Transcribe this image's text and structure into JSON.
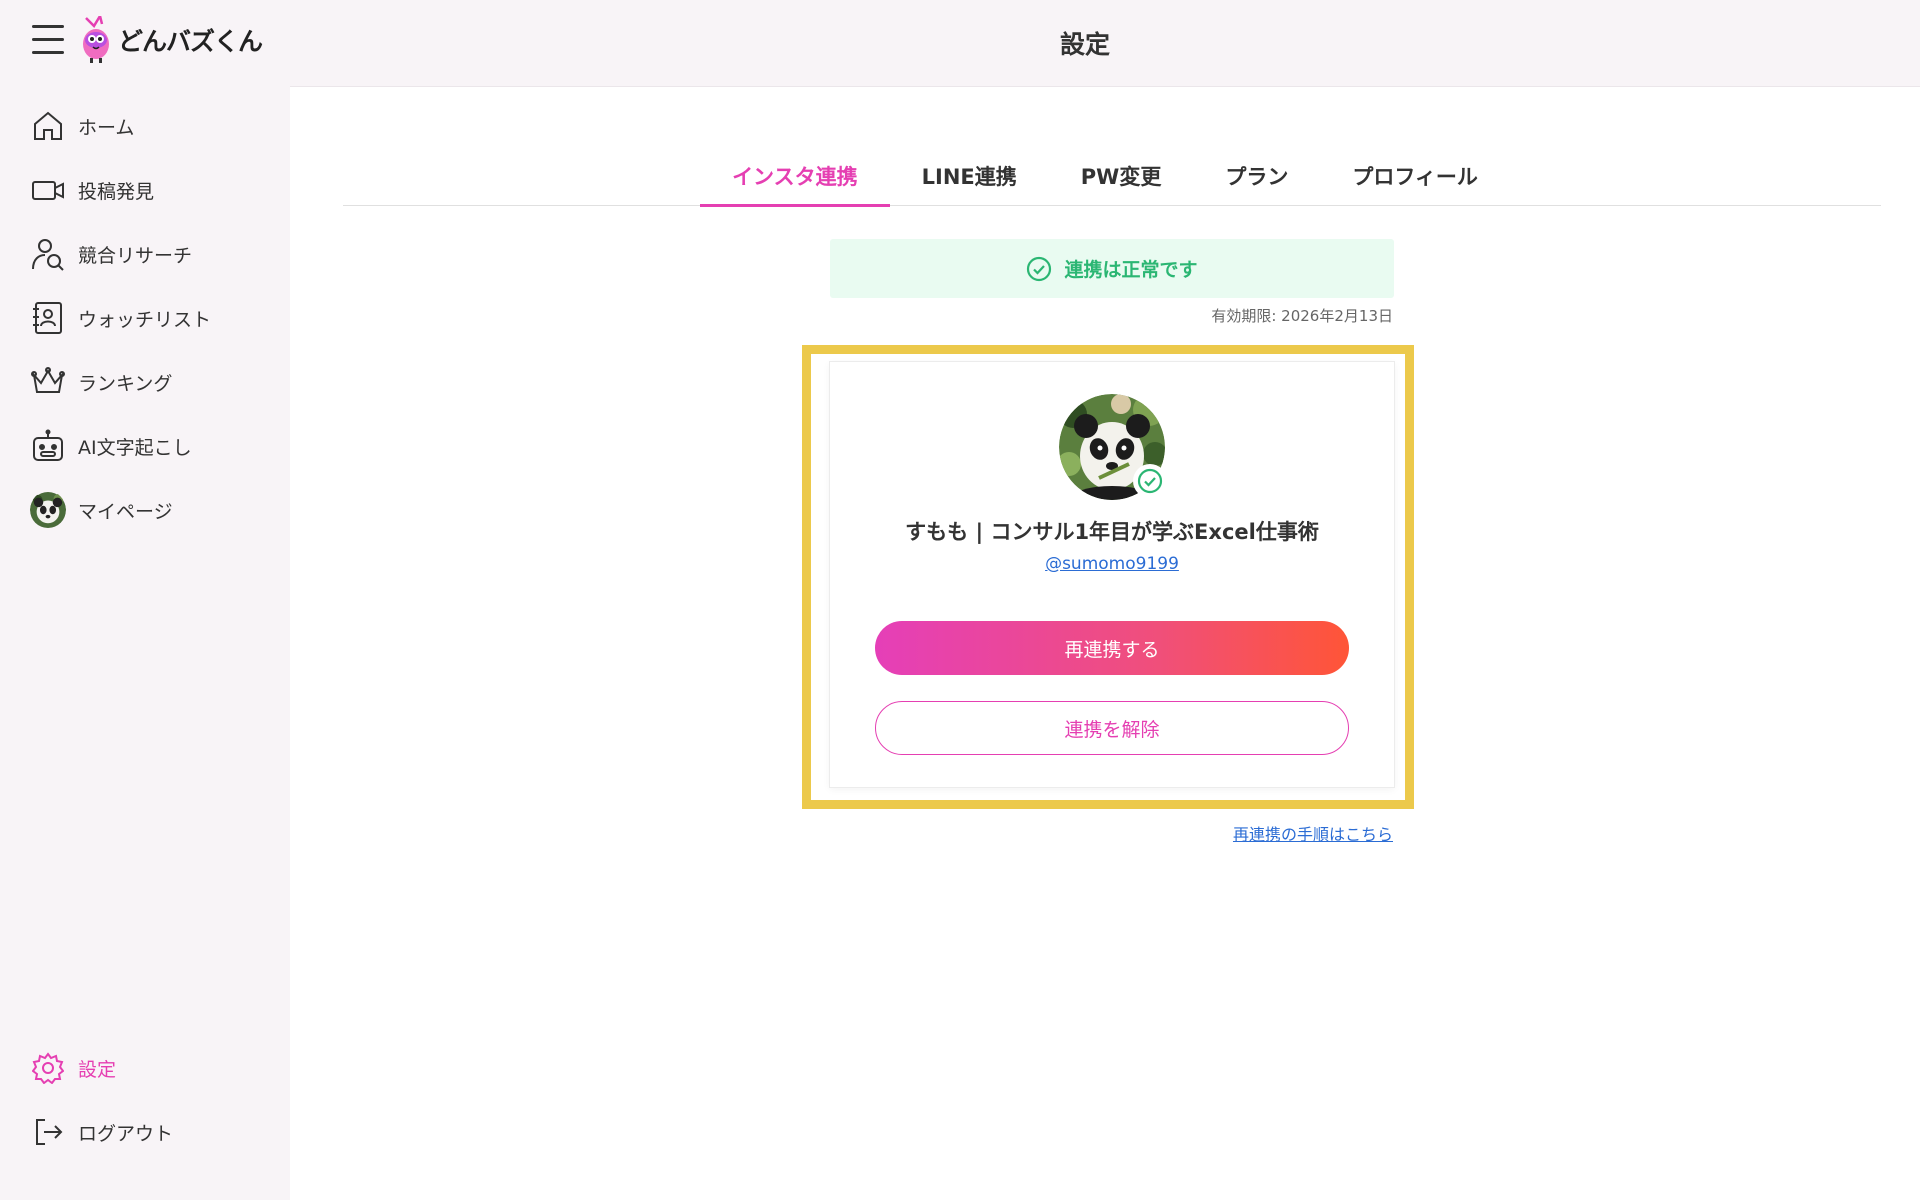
{
  "app": {
    "name": "どんバズくん"
  },
  "header": {
    "title": "設定"
  },
  "sidebar": {
    "items": [
      {
        "label": "ホーム",
        "icon": "home-icon"
      },
      {
        "label": "投稿発見",
        "icon": "video-camera-icon"
      },
      {
        "label": "競合リサーチ",
        "icon": "user-search-icon"
      },
      {
        "label": "ウォッチリスト",
        "icon": "contacts-book-icon"
      },
      {
        "label": "ランキング",
        "icon": "crown-icon"
      },
      {
        "label": "AI文字起こし",
        "icon": "robot-icon"
      },
      {
        "label": "マイページ",
        "icon": "avatar"
      }
    ],
    "bottom": [
      {
        "label": "設定",
        "icon": "gear-icon",
        "active": true
      },
      {
        "label": "ログアウト",
        "icon": "logout-icon"
      }
    ]
  },
  "tabs": [
    {
      "label": "インスタ連携",
      "active": true
    },
    {
      "label": "LINE連携"
    },
    {
      "label": "PW変更"
    },
    {
      "label": "プラン"
    },
    {
      "label": "プロフィール"
    }
  ],
  "status": {
    "text": "連携は正常です",
    "color": "#2bb673"
  },
  "expiry": "有効期限: 2026年2月13日",
  "account": {
    "name": "すもも | コンサル1年目が学ぶExcel仕事術",
    "handle": "@sumomo9199"
  },
  "buttons": {
    "relink": "再連携する",
    "unlink": "連携を解除"
  },
  "help_link": "再連携の手順はこちら",
  "colors": {
    "accent": "#e53fb2",
    "highlight": "#ecc94b",
    "link": "#2b6cd4"
  }
}
